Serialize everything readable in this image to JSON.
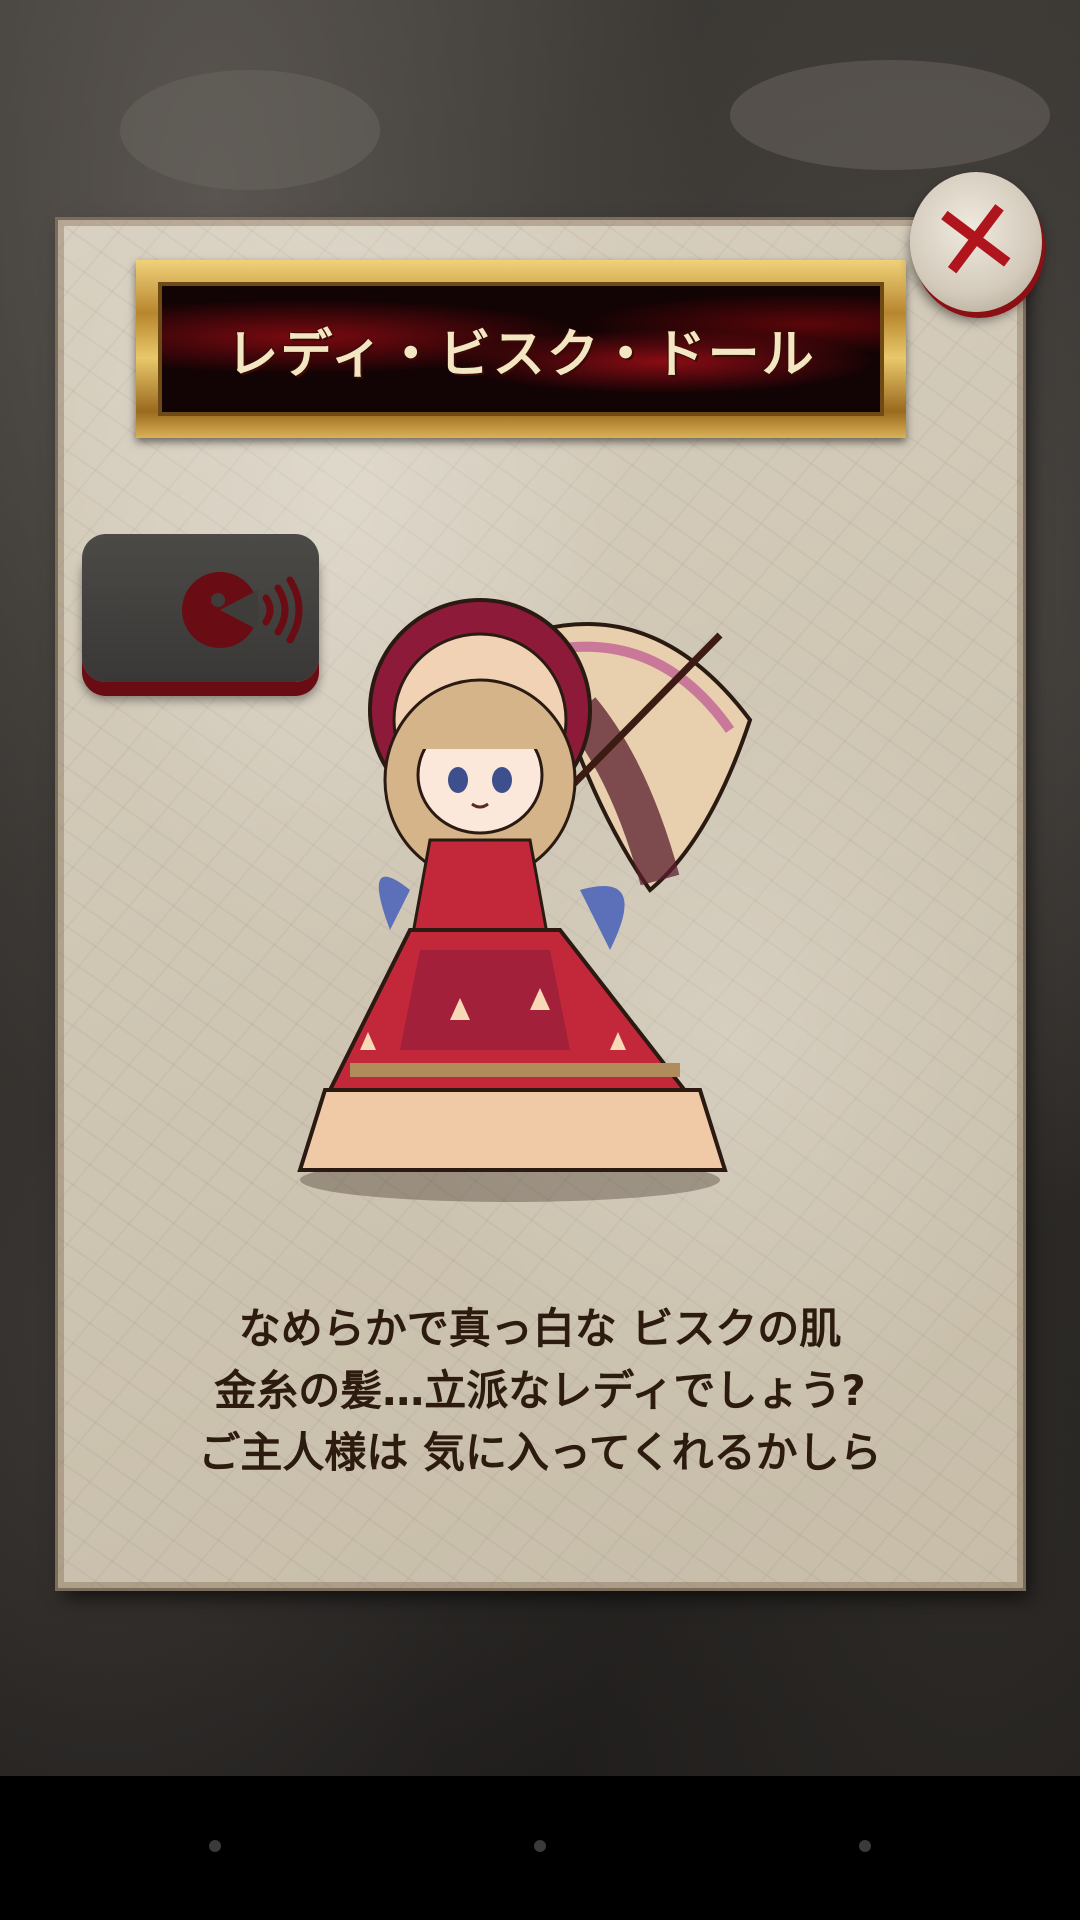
{
  "card": {
    "title": "レディ・ビスク・ドール",
    "description_lines": [
      "なめらかで真っ白な ビスクの肌",
      "金糸の髪…立派なレディでしょう?",
      "ご主人様は 気に入ってくれるかしら"
    ]
  },
  "close_button": {
    "icon": "close-x-icon",
    "symbol": "✕"
  },
  "voice_button": {
    "icon": "voice-playback-icon"
  },
  "character": {
    "icon": "lady-bisque-doll-illustration"
  },
  "colors": {
    "accent_red": "#b0141c",
    "gold_frame": "#d9b257",
    "paper": "#cfc6b4"
  }
}
